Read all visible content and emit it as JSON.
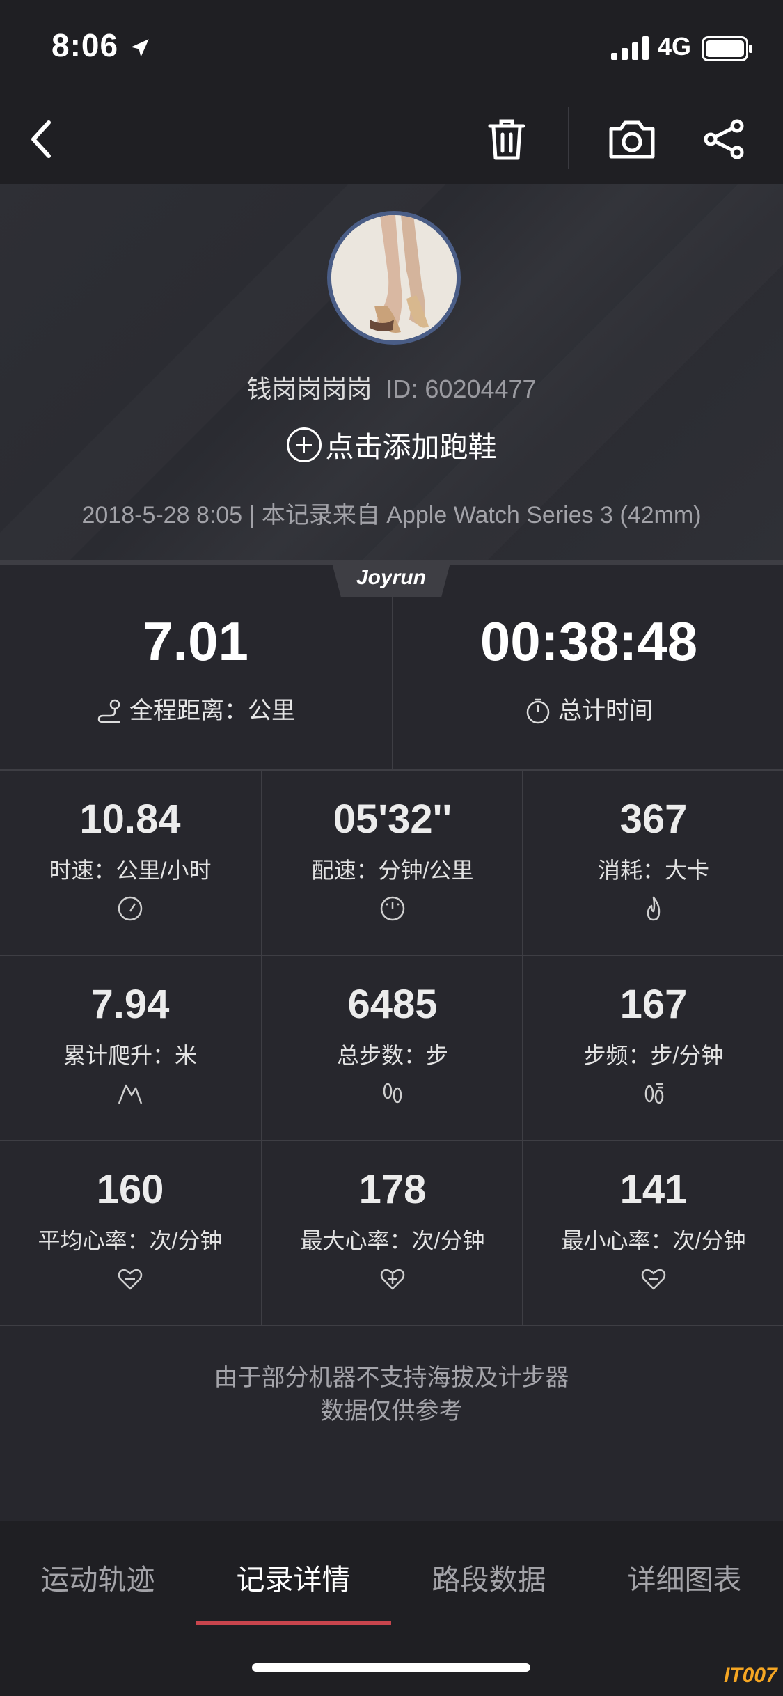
{
  "status_bar": {
    "time": "8:06",
    "network": "4G"
  },
  "profile": {
    "username": "钱岗岗岗岗",
    "user_id": "ID: 60204477",
    "add_shoes": "点击添加跑鞋",
    "record_info": "2018-5-28 8:05 | 本记录来自 Apple Watch Series 3 (42mm)",
    "brand": "Joyrun"
  },
  "summary": {
    "distance_value": "7.01",
    "distance_label": "全程距离：公里",
    "time_value": "00:38:48",
    "time_label": "总计时间"
  },
  "stats": [
    {
      "value": "10.84",
      "label": "时速：公里/小时",
      "icon": "speedometer-icon"
    },
    {
      "value": "05'32''",
      "label": "配速：分钟/公里",
      "icon": "pace-gauge-icon"
    },
    {
      "value": "367",
      "label": "消耗：大卡",
      "icon": "flame-icon"
    },
    {
      "value": "7.94",
      "label": "累计爬升：米",
      "icon": "mountain-icon"
    },
    {
      "value": "6485",
      "label": "总步数：步",
      "icon": "footprints-icon"
    },
    {
      "value": "167",
      "label": "步频：步/分钟",
      "icon": "cadence-icon"
    },
    {
      "value": "160",
      "label": "平均心率：次/分钟",
      "icon": "heart-avg-icon"
    },
    {
      "value": "178",
      "label": "最大心率：次/分钟",
      "icon": "heart-max-icon"
    },
    {
      "value": "141",
      "label": "最小心率：次/分钟",
      "icon": "heart-min-icon"
    }
  ],
  "note": {
    "line1": "由于部分机器不支持海拔及计步器",
    "line2": "数据仅供参考"
  },
  "tabs": [
    {
      "label": "运动轨迹"
    },
    {
      "label": "记录详情"
    },
    {
      "label": "路段数据"
    },
    {
      "label": "详细图表"
    }
  ],
  "watermark": "IT007",
  "colors": {
    "accent": "#c8454d",
    "background": "#27272d",
    "bar": "#1f1f23"
  }
}
